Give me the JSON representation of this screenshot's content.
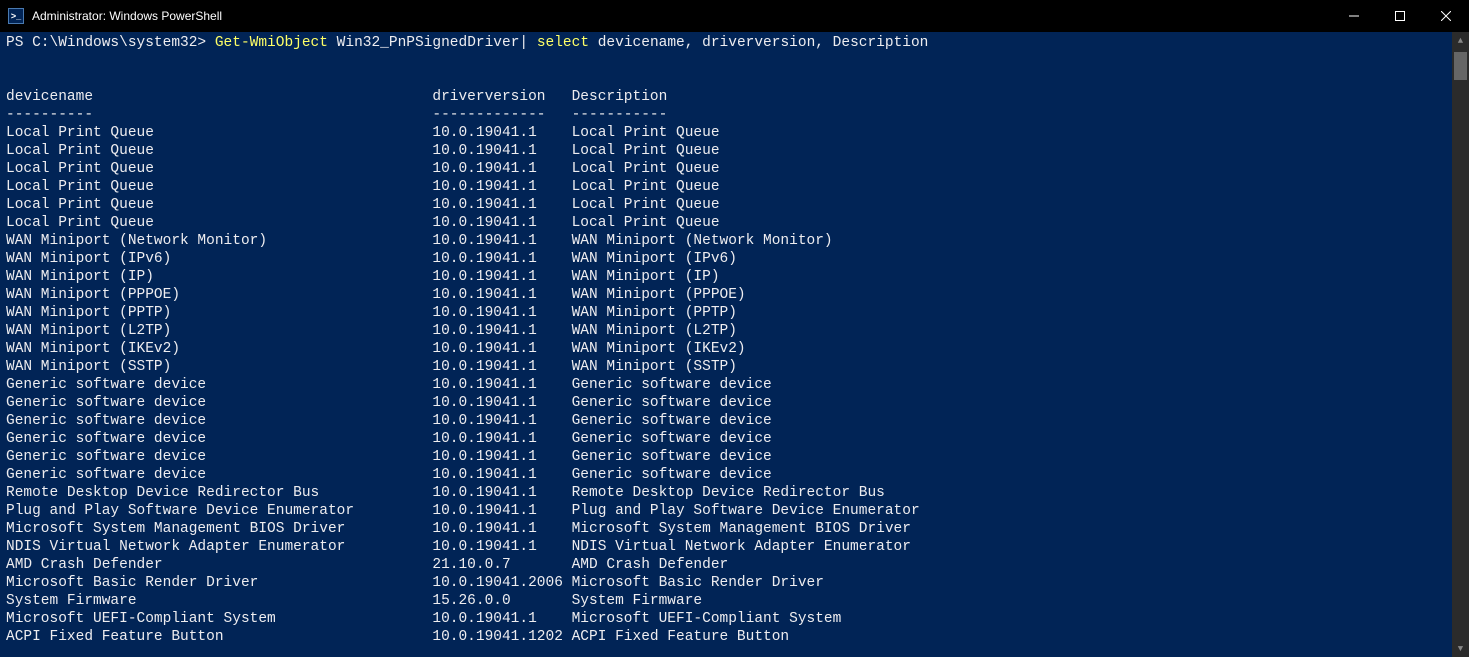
{
  "window": {
    "title": "Administrator: Windows PowerShell"
  },
  "prompt": {
    "path": "PS C:\\Windows\\system32>",
    "cmdlet1": "Get-WmiObject",
    "arg1": "Win32_PnPSignedDriver",
    "pipe": "|",
    "cmdlet2": "select",
    "params": "devicename, driverversion, Description"
  },
  "table": {
    "headers": {
      "c1": "devicename",
      "c2": "driverversion",
      "c3": "Description"
    },
    "dashes": {
      "c1": "----------",
      "c2": "-------------",
      "c3": "-----------"
    },
    "col_widths": {
      "c1": 49,
      "c2": 16
    },
    "rows": [
      {
        "c1": "Local Print Queue",
        "c2": "10.0.19041.1",
        "c3": "Local Print Queue"
      },
      {
        "c1": "Local Print Queue",
        "c2": "10.0.19041.1",
        "c3": "Local Print Queue"
      },
      {
        "c1": "Local Print Queue",
        "c2": "10.0.19041.1",
        "c3": "Local Print Queue"
      },
      {
        "c1": "Local Print Queue",
        "c2": "10.0.19041.1",
        "c3": "Local Print Queue"
      },
      {
        "c1": "Local Print Queue",
        "c2": "10.0.19041.1",
        "c3": "Local Print Queue"
      },
      {
        "c1": "Local Print Queue",
        "c2": "10.0.19041.1",
        "c3": "Local Print Queue"
      },
      {
        "c1": "WAN Miniport (Network Monitor)",
        "c2": "10.0.19041.1",
        "c3": "WAN Miniport (Network Monitor)"
      },
      {
        "c1": "WAN Miniport (IPv6)",
        "c2": "10.0.19041.1",
        "c3": "WAN Miniport (IPv6)"
      },
      {
        "c1": "WAN Miniport (IP)",
        "c2": "10.0.19041.1",
        "c3": "WAN Miniport (IP)"
      },
      {
        "c1": "WAN Miniport (PPPOE)",
        "c2": "10.0.19041.1",
        "c3": "WAN Miniport (PPPOE)"
      },
      {
        "c1": "WAN Miniport (PPTP)",
        "c2": "10.0.19041.1",
        "c3": "WAN Miniport (PPTP)"
      },
      {
        "c1": "WAN Miniport (L2TP)",
        "c2": "10.0.19041.1",
        "c3": "WAN Miniport (L2TP)"
      },
      {
        "c1": "WAN Miniport (IKEv2)",
        "c2": "10.0.19041.1",
        "c3": "WAN Miniport (IKEv2)"
      },
      {
        "c1": "WAN Miniport (SSTP)",
        "c2": "10.0.19041.1",
        "c3": "WAN Miniport (SSTP)"
      },
      {
        "c1": "Generic software device",
        "c2": "10.0.19041.1",
        "c3": "Generic software device"
      },
      {
        "c1": "Generic software device",
        "c2": "10.0.19041.1",
        "c3": "Generic software device"
      },
      {
        "c1": "Generic software device",
        "c2": "10.0.19041.1",
        "c3": "Generic software device"
      },
      {
        "c1": "Generic software device",
        "c2": "10.0.19041.1",
        "c3": "Generic software device"
      },
      {
        "c1": "Generic software device",
        "c2": "10.0.19041.1",
        "c3": "Generic software device"
      },
      {
        "c1": "Generic software device",
        "c2": "10.0.19041.1",
        "c3": "Generic software device"
      },
      {
        "c1": "Remote Desktop Device Redirector Bus",
        "c2": "10.0.19041.1",
        "c3": "Remote Desktop Device Redirector Bus"
      },
      {
        "c1": "Plug and Play Software Device Enumerator",
        "c2": "10.0.19041.1",
        "c3": "Plug and Play Software Device Enumerator"
      },
      {
        "c1": "Microsoft System Management BIOS Driver",
        "c2": "10.0.19041.1",
        "c3": "Microsoft System Management BIOS Driver"
      },
      {
        "c1": "NDIS Virtual Network Adapter Enumerator",
        "c2": "10.0.19041.1",
        "c3": "NDIS Virtual Network Adapter Enumerator"
      },
      {
        "c1": "AMD Crash Defender",
        "c2": "21.10.0.7",
        "c3": "AMD Crash Defender"
      },
      {
        "c1": "Microsoft Basic Render Driver",
        "c2": "10.0.19041.2006",
        "c3": "Microsoft Basic Render Driver"
      },
      {
        "c1": "System Firmware",
        "c2": "15.26.0.0",
        "c3": "System Firmware"
      },
      {
        "c1": "Microsoft UEFI-Compliant System",
        "c2": "10.0.19041.1",
        "c3": "Microsoft UEFI-Compliant System"
      },
      {
        "c1": "ACPI Fixed Feature Button",
        "c2": "10.0.19041.1202",
        "c3": "ACPI Fixed Feature Button"
      }
    ]
  }
}
